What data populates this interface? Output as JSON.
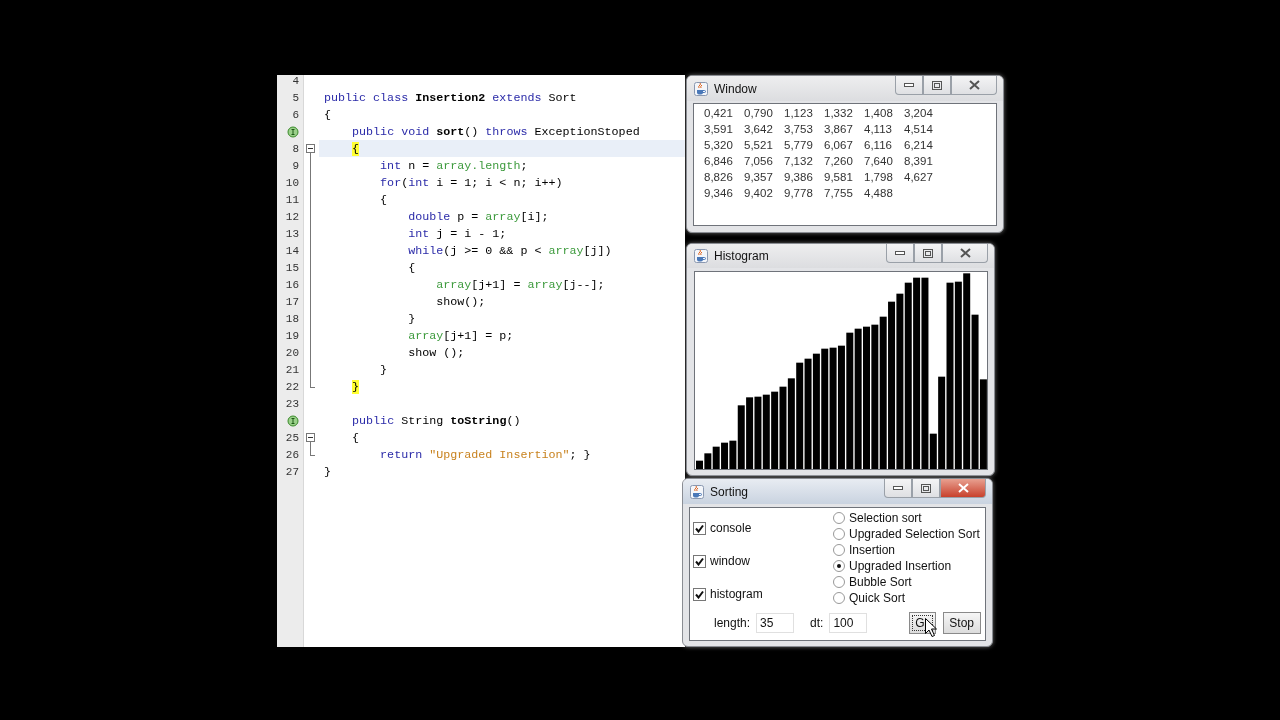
{
  "editor": {
    "lines": [
      {
        "number": "4",
        "override": false,
        "collapsible": false,
        "in_fold": false,
        "fold_end": false,
        "current": false
      },
      {
        "number": "5",
        "override": false,
        "collapsible": false,
        "in_fold": false,
        "fold_end": false,
        "current": false,
        "tokens": [
          {
            "kind": "keyword",
            "text": "public class"
          },
          {
            "kind": "bold",
            "text": " Insertion2 "
          },
          {
            "kind": "keyword",
            "text": "extends"
          },
          {
            "kind": "plain",
            "text": " Sort"
          }
        ]
      },
      {
        "number": "6",
        "override": false,
        "collapsible": false,
        "in_fold": false,
        "fold_end": false,
        "current": false,
        "tokens": [
          {
            "kind": "plain",
            "text": "{"
          }
        ]
      },
      {
        "override": true,
        "collapsible": false,
        "in_fold": false,
        "fold_end": false,
        "current": false,
        "tokens": [
          {
            "kind": "keyword",
            "text": "    public void"
          },
          {
            "kind": "bold",
            "text": " sort"
          },
          {
            "kind": "plain",
            "text": "() "
          },
          {
            "kind": "keyword",
            "text": "throws"
          },
          {
            "kind": "plain",
            "text": " ExceptionStoped"
          }
        ]
      },
      {
        "number": "8",
        "override": false,
        "collapsible": true,
        "in_fold": false,
        "fold_end": false,
        "current": true,
        "tokens": [
          {
            "kind": "match",
            "text": "    {"
          }
        ]
      },
      {
        "number": "9",
        "override": false,
        "collapsible": false,
        "in_fold": true,
        "fold_end": false,
        "current": false,
        "tokens": [
          {
            "kind": "keyword",
            "text": "        int"
          },
          {
            "kind": "plain",
            "text": " n = "
          },
          {
            "kind": "field",
            "text": "array.length"
          },
          {
            "kind": "plain",
            "text": ";"
          }
        ]
      },
      {
        "number": "10",
        "override": false,
        "collapsible": false,
        "in_fold": true,
        "fold_end": false,
        "current": false,
        "tokens": [
          {
            "kind": "keyword",
            "text": "        for"
          },
          {
            "kind": "plain",
            "text": "("
          },
          {
            "kind": "keyword",
            "text": "int"
          },
          {
            "kind": "plain",
            "text": " i = 1; i < n; i++)"
          }
        ]
      },
      {
        "number": "11",
        "override": false,
        "collapsible": false,
        "in_fold": true,
        "fold_end": false,
        "current": false,
        "tokens": [
          {
            "kind": "plain",
            "text": "        {"
          }
        ]
      },
      {
        "number": "12",
        "override": false,
        "collapsible": false,
        "in_fold": true,
        "fold_end": false,
        "current": false,
        "tokens": [
          {
            "kind": "keyword",
            "text": "            double"
          },
          {
            "kind": "plain",
            "text": " p = "
          },
          {
            "kind": "field",
            "text": "array"
          },
          {
            "kind": "plain",
            "text": "[i];"
          }
        ]
      },
      {
        "number": "13",
        "override": false,
        "collapsible": false,
        "in_fold": true,
        "fold_end": false,
        "current": false,
        "tokens": [
          {
            "kind": "keyword",
            "text": "            int"
          },
          {
            "kind": "plain",
            "text": " j = i - 1;"
          }
        ]
      },
      {
        "number": "14",
        "override": false,
        "collapsible": false,
        "in_fold": true,
        "fold_end": false,
        "current": false,
        "tokens": [
          {
            "kind": "keyword",
            "text": "            while"
          },
          {
            "kind": "plain",
            "text": "(j >= 0 && p < "
          },
          {
            "kind": "field",
            "text": "array"
          },
          {
            "kind": "plain",
            "text": "[j])"
          }
        ]
      },
      {
        "number": "15",
        "override": false,
        "collapsible": false,
        "in_fold": true,
        "fold_end": false,
        "current": false,
        "tokens": [
          {
            "kind": "plain",
            "text": "            {"
          }
        ]
      },
      {
        "number": "16",
        "override": false,
        "collapsible": false,
        "in_fold": true,
        "fold_end": false,
        "current": false,
        "tokens": [
          {
            "kind": "field",
            "text": "                array"
          },
          {
            "kind": "plain",
            "text": "[j+1] = "
          },
          {
            "kind": "field",
            "text": "array"
          },
          {
            "kind": "plain",
            "text": "[j--];"
          }
        ]
      },
      {
        "number": "17",
        "override": false,
        "collapsible": false,
        "in_fold": true,
        "fold_end": false,
        "current": false,
        "tokens": [
          {
            "kind": "plain",
            "text": "                show();"
          }
        ]
      },
      {
        "number": "18",
        "override": false,
        "collapsible": false,
        "in_fold": true,
        "fold_end": false,
        "current": false,
        "tokens": [
          {
            "kind": "plain",
            "text": "            }"
          }
        ]
      },
      {
        "number": "19",
        "override": false,
        "collapsible": false,
        "in_fold": true,
        "fold_end": false,
        "current": false,
        "tokens": [
          {
            "kind": "field",
            "text": "            array"
          },
          {
            "kind": "plain",
            "text": "[j+1] = p;"
          }
        ]
      },
      {
        "number": "20",
        "override": false,
        "collapsible": false,
        "in_fold": true,
        "fold_end": false,
        "current": false,
        "tokens": [
          {
            "kind": "plain",
            "text": "            show ();"
          }
        ]
      },
      {
        "number": "21",
        "override": false,
        "collapsible": false,
        "in_fold": true,
        "fold_end": false,
        "current": false,
        "tokens": [
          {
            "kind": "plain",
            "text": "        }"
          }
        ]
      },
      {
        "number": "22",
        "override": false,
        "collapsible": false,
        "in_fold": false,
        "fold_end": true,
        "current": false,
        "tokens": [
          {
            "kind": "match",
            "text": "    }"
          }
        ]
      },
      {
        "number": "23",
        "override": false,
        "collapsible": false,
        "in_fold": false,
        "fold_end": false,
        "current": false
      },
      {
        "override": true,
        "collapsible": false,
        "in_fold": false,
        "fold_end": false,
        "current": false,
        "tokens": [
          {
            "kind": "keyword",
            "text": "    public"
          },
          {
            "kind": "plain",
            "text": " String "
          },
          {
            "kind": "bold",
            "text": "toString"
          },
          {
            "kind": "plain",
            "text": "()"
          }
        ]
      },
      {
        "number": "25",
        "override": false,
        "collapsible": true,
        "in_fold": false,
        "fold_end": false,
        "current": false,
        "tokens": [
          {
            "kind": "plain",
            "text": "    {"
          }
        ]
      },
      {
        "number": "26",
        "override": false,
        "collapsible": false,
        "in_fold": false,
        "fold_end": true,
        "current": false,
        "tokens": [
          {
            "kind": "keyword",
            "text": "        return"
          },
          {
            "kind": "string",
            "text": " \"Upgraded Insertion\""
          },
          {
            "kind": "plain",
            "text": "; }"
          }
        ]
      },
      {
        "number": "27",
        "override": false,
        "collapsible": false,
        "in_fold": false,
        "fold_end": false,
        "current": false,
        "tokens": [
          {
            "kind": "plain",
            "text": "}"
          }
        ]
      }
    ]
  },
  "values_window": {
    "title": "Window",
    "active": false,
    "rows": [
      [
        "0,421",
        "0,790",
        "1,123",
        "1,332",
        "1,408",
        "3,204"
      ],
      [
        "3,591",
        "3,642",
        "3,753",
        "3,867",
        "4,113",
        "4,514"
      ],
      [
        "5,320",
        "5,521",
        "5,779",
        "6,067",
        "6,116",
        "6,214"
      ],
      [
        "6,846",
        "7,056",
        "7,132",
        "7,260",
        "7,640",
        "8,391"
      ],
      [
        "8,826",
        "9,357",
        "9,386",
        "9,581",
        "1,798",
        "4,627"
      ],
      [
        "9,346",
        "9,402",
        "9,778",
        "7,755",
        "4,488"
      ]
    ]
  },
  "histogram_window": {
    "title": "Histogram",
    "active": false
  },
  "sorting_window": {
    "title": "Sorting",
    "active": true,
    "checkboxes": [
      {
        "label": "console",
        "checked": true
      },
      {
        "label": "window",
        "checked": true
      },
      {
        "label": "histogram",
        "checked": true
      }
    ],
    "algorithms": [
      {
        "label": "Selection sort",
        "selected": false
      },
      {
        "label": "Upgraded Selection Sort",
        "selected": false
      },
      {
        "label": "Insertion",
        "selected": false
      },
      {
        "label": "Upgraded Insertion",
        "selected": true
      },
      {
        "label": "Bubble Sort",
        "selected": false
      },
      {
        "label": "Quick Sort",
        "selected": false
      }
    ],
    "fields": [
      {
        "label": "length:",
        "value": "35"
      },
      {
        "label": "dt:",
        "value": "100"
      }
    ],
    "buttons": [
      {
        "label": "G",
        "focused": true
      },
      {
        "label": "Stop",
        "focused": false
      }
    ]
  }
}
